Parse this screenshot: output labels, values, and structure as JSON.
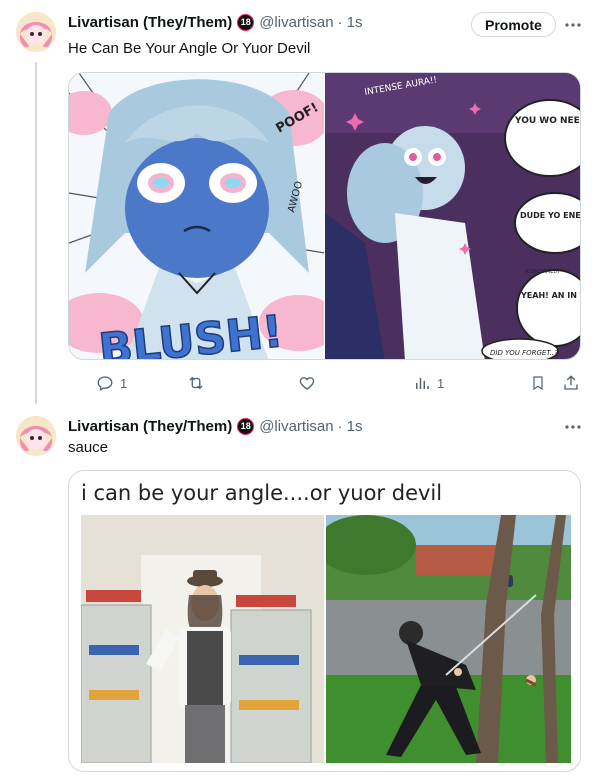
{
  "tweets": [
    {
      "author_name": "Livartisan (They/Them)",
      "badge": "18",
      "handle": "@livartisan",
      "separator": "·",
      "time": "1s",
      "text": "He Can Be Your Angle Or Yuor Devil",
      "promote_label": "Promote",
      "more_icon": "more-icon",
      "comic_left_text": {
        "sfx_top": "POOF!",
        "sfx_side": "AWOO",
        "blush": "BLUSH!"
      },
      "comic_right_text": {
        "aura": "INTENSE AURA!!",
        "bubble1": "YOU WO NEED Y WORR AT A",
        "bubble2": "DUDE YO ENERGY WILD NO",
        "bubble3": "YEAH! AN IN THE COUN",
        "tag": "(CONFIRMED)",
        "bubble4": "DID YOU FORGET..?"
      },
      "actions": {
        "reply_count": "1",
        "retweet_count": "",
        "like_count": "",
        "views_count": "1"
      }
    },
    {
      "author_name": "Livartisan (They/Them)",
      "badge": "18",
      "handle": "@livartisan",
      "separator": "·",
      "time": "1s",
      "text": "sauce",
      "meme_title": "i can be your angle....or yuor devil"
    }
  ],
  "icons": [
    "reply-icon",
    "retweet-icon",
    "like-icon",
    "views-icon",
    "bookmark-icon",
    "share-icon",
    "more-icon"
  ],
  "colors": {
    "accent_grey": "#536471",
    "border": "#cfd9de",
    "badge_ring": "#e0245e"
  }
}
